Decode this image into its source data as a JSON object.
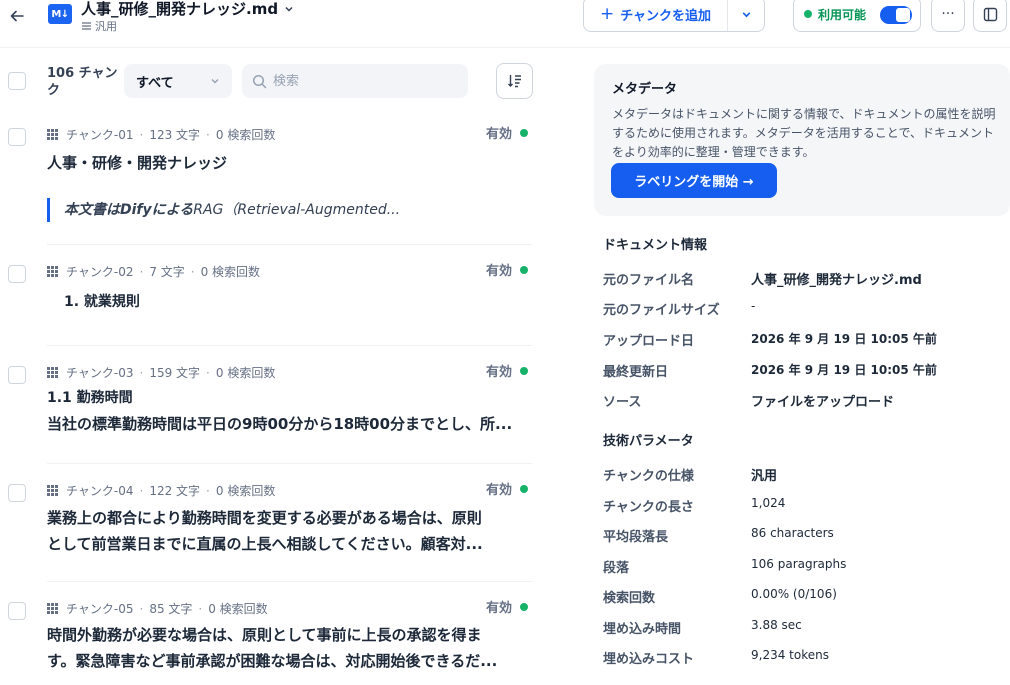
{
  "header": {
    "file_title": "人事_研修_開発ナレッジ.md",
    "file_icon_text": "M↓",
    "subtitle": "汎用",
    "add_chunk_label": "チャンクを追加",
    "availability_label": "利用可能",
    "more_label": "···"
  },
  "toolbar": {
    "count_label": "106 チャンク",
    "filter_value": "すべて",
    "search_placeholder": "検索"
  },
  "chunks": [
    {
      "id": "チャンク-01",
      "chars": "123 文字",
      "retrievals": "0 検索回数",
      "status": "有効",
      "title": "人事・研修・開発ナレッジ",
      "quote_bold": "本文書はDifyによる",
      "quote_rest": "RAG（Retrieval-Augmented..."
    },
    {
      "id": "チャンク-02",
      "chars": "7 文字",
      "retrievals": "0 検索回数",
      "status": "有効",
      "text": "1. 就業規則"
    },
    {
      "id": "チャンク-03",
      "chars": "159 文字",
      "retrievals": "0 検索回数",
      "status": "有効",
      "line1": "1.1 勤務時間",
      "line2": "当社の標準勤務時間は平日の9時00分から18時00分までとし、所..."
    },
    {
      "id": "チャンク-04",
      "chars": "122 文字",
      "retrievals": "0 検索回数",
      "status": "有効",
      "line1": "業務上の都合により勤務時間を変更する必要がある場合は、原則",
      "line2": "として前営業日までに直属の上長へ相談してください。顧客対..."
    },
    {
      "id": "チャンク-05",
      "chars": "85 文字",
      "retrievals": "0 検索回数",
      "status": "有効",
      "line1": "時間外勤務が必要な場合は、原則として事前に上長の承認を得ま",
      "line2": "す。緊急障害など事前承認が困難な場合は、対応開始後できるだ..."
    }
  ],
  "metadata": {
    "title": "メタデータ",
    "description": "メタデータはドキュメントに関する情報で、ドキュメントの属性を説明するために使用されます。メタデータを活用することで、ドキュメントをより効率的に整理・管理できます。",
    "button_label": "ラベリングを開始 →"
  },
  "doc_info": {
    "title": "ドキュメント情報",
    "rows": [
      {
        "k": "元のファイル名",
        "v": "人事_研修_開発ナレッジ.md"
      },
      {
        "k": "元のファイルサイズ",
        "v": "-"
      },
      {
        "k": "アップロード日",
        "v": "2026 年 9 月 19 日 10:05 午前"
      },
      {
        "k": "最終更新日",
        "v": "2026 年 9 月 19 日 10:05 午前"
      },
      {
        "k": "ソース",
        "v": "ファイルをアップロード"
      }
    ]
  },
  "tech_params": {
    "title": "技術パラメータ",
    "rows": [
      {
        "k": "チャンクの仕様",
        "v": "汎用"
      },
      {
        "k": "チャンクの長さ",
        "v": "1,024"
      },
      {
        "k": "平均段落長",
        "v": "86 characters"
      },
      {
        "k": "段落",
        "v": "106 paragraphs"
      },
      {
        "k": "検索回数",
        "v": "0.00% (0/106)"
      },
      {
        "k": "埋め込み時間",
        "v": "3.88 sec"
      },
      {
        "k": "埋め込みコスト",
        "v": "9,234 tokens"
      }
    ]
  },
  "colors": {
    "accent": "#155eef",
    "enabled_dot": "#17b26a"
  }
}
